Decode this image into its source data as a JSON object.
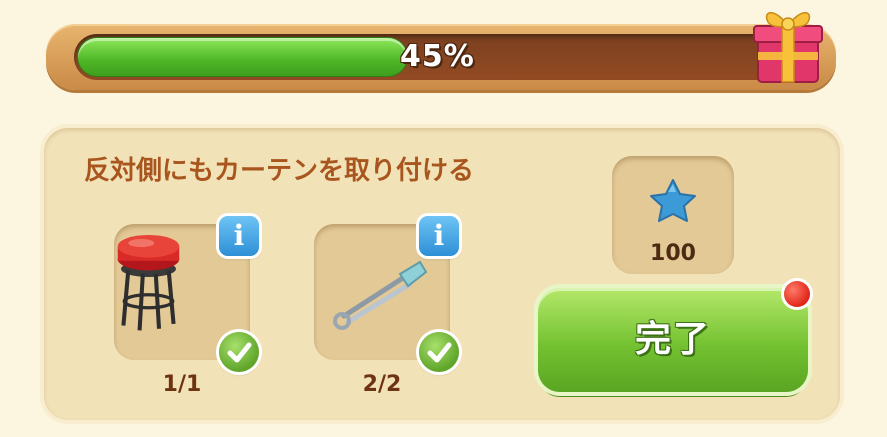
{
  "progress": {
    "percent_value": 0.45,
    "label": "45%"
  },
  "task": {
    "title": "反対側にもカーテンを取り付ける",
    "items": [
      {
        "icon": "bar-stool-icon",
        "count": "1/1",
        "info": "i",
        "completed": true
      },
      {
        "icon": "safety-pin-icon",
        "count": "2/2",
        "info": "i",
        "completed": true
      }
    ]
  },
  "reward": {
    "icon": "blue-star-icon",
    "amount": "100"
  },
  "complete_button": {
    "label": "完了",
    "has_notification": true
  },
  "colors": {
    "progress_fill": "#4db626",
    "button_green": "#74c232",
    "title_brown": "#a8561e",
    "notify_red": "#e02618"
  }
}
